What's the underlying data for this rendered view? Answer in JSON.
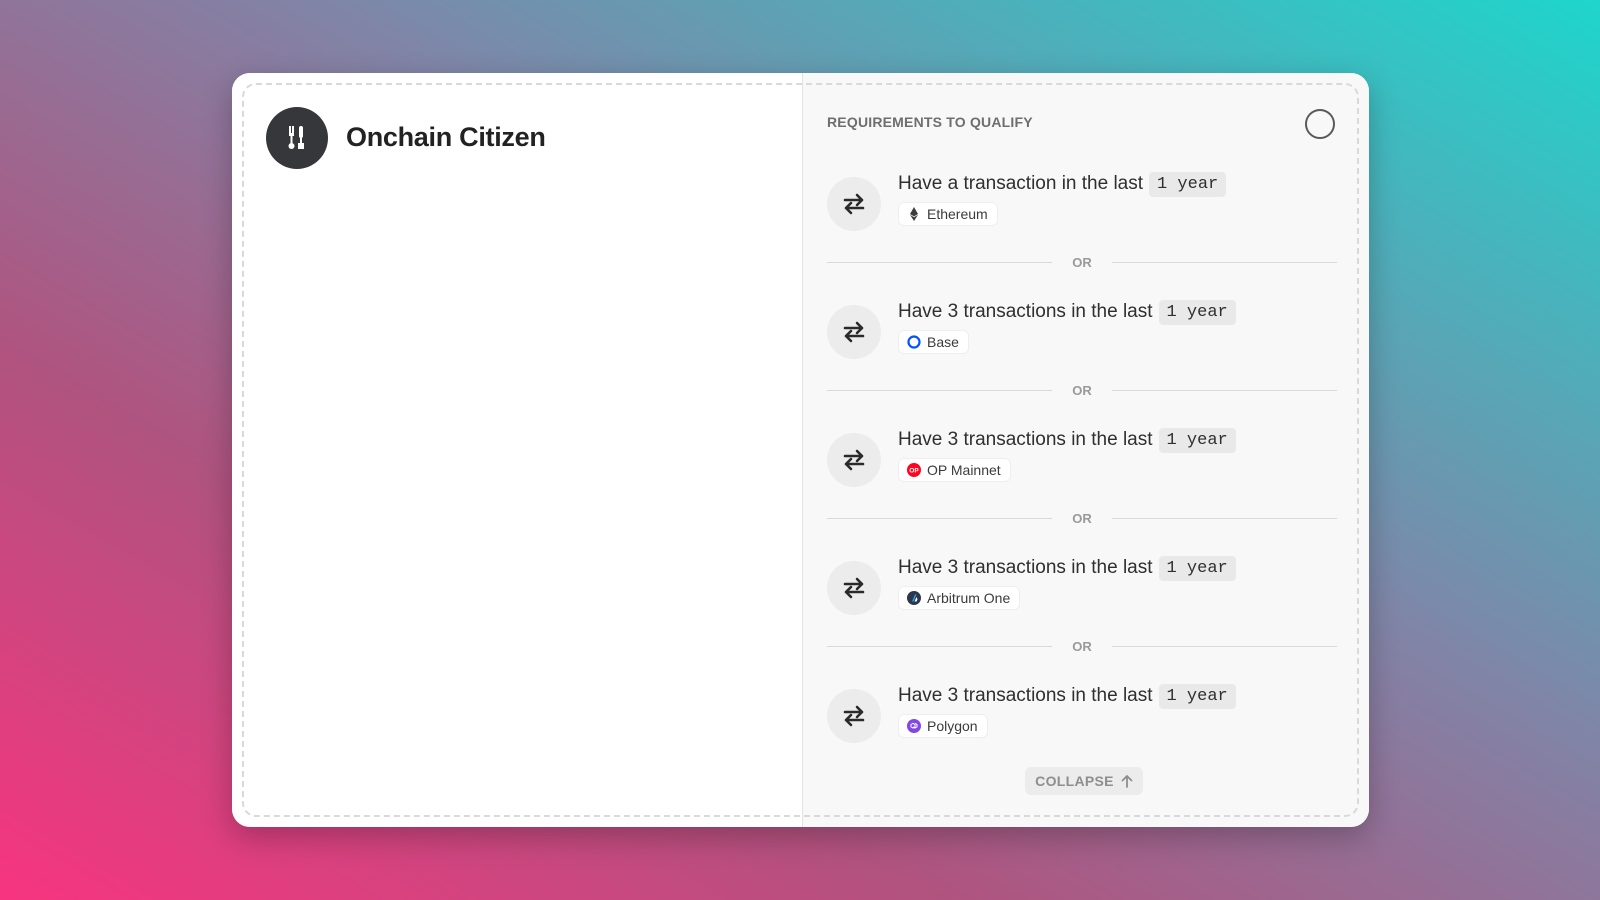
{
  "brand": {
    "title": "Onchain Citizen"
  },
  "requirements": {
    "header": "REQUIREMENTS TO QUALIFY",
    "separator": "OR",
    "items": [
      {
        "label": "Have a transaction in the last",
        "period": "1 year",
        "chain": "Ethereum",
        "chain_icon": "ethereum-icon"
      },
      {
        "label": "Have 3 transactions in the last",
        "period": "1 year",
        "chain": "Base",
        "chain_icon": "base-icon"
      },
      {
        "label": "Have 3 transactions in the last",
        "period": "1 year",
        "chain": "OP Mainnet",
        "chain_icon": "op-mainnet-icon"
      },
      {
        "label": "Have 3 transactions in the last",
        "period": "1 year",
        "chain": "Arbitrum One",
        "chain_icon": "arbitrum-icon"
      },
      {
        "label": "Have 3 transactions in the last",
        "period": "1 year",
        "chain": "Polygon",
        "chain_icon": "polygon-icon"
      }
    ],
    "collapse_label": "COLLAPSE"
  },
  "colors": {
    "logo_bg": "#36373b",
    "base": "#0052ff",
    "op": "#ff0420",
    "arbitrum": "#2d374b",
    "polygon": "#8247e5"
  }
}
